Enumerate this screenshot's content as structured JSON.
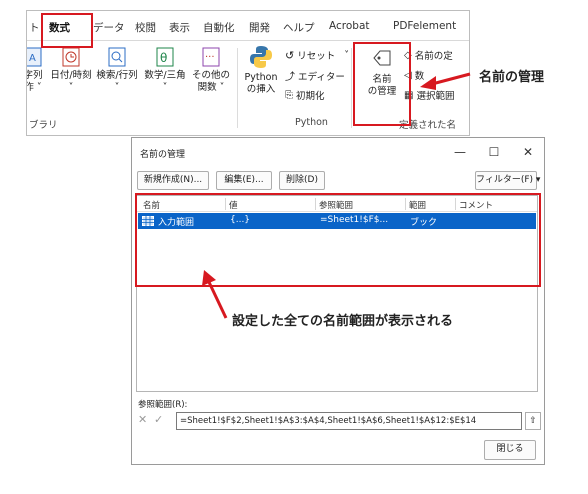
{
  "ribbon": {
    "tabs": [
      "ト",
      "数式",
      "データ",
      "校閲",
      "表示",
      "自動化",
      "開発",
      "ヘルプ",
      "Acrobat",
      "PDFelement"
    ],
    "active_tab": "数式",
    "groups": {
      "library": {
        "label": "ブラリ",
        "buttons": [
          {
            "label": "字列",
            "sub": "作 ˅"
          },
          {
            "label": "日付/時刻",
            "sub": "˅"
          },
          {
            "label": "検索/行列",
            "sub": "˅"
          },
          {
            "label": "数学/三角",
            "sub": "˅"
          },
          {
            "label": "その他の",
            "sub": "関数 ˅"
          }
        ]
      },
      "python": {
        "label": "Python",
        "insert_label": "Python",
        "insert_sub": "の挿入",
        "reset": "リセット",
        "editor": "エディター",
        "init": "初期化",
        "reset_dropdown": "˅"
      },
      "names": {
        "manager_label": "名前",
        "manager_sub": "の管理",
        "define": "名前の定",
        "use": "数",
        "create": "選択範囲",
        "group_label": "定義された名"
      }
    }
  },
  "callouts": {
    "name_manager": "名前の管理",
    "all_ranges": "設定した全ての名前範囲が表示される"
  },
  "dialog": {
    "title": "名前の管理",
    "window_buttons": {
      "minimize": "—",
      "maximize": "☐",
      "close": "✕"
    },
    "buttons": {
      "new": "新規作成(N)...",
      "edit": "編集(E)...",
      "delete": "削除(D)",
      "filter": "フィルター(F) ▾"
    },
    "columns": [
      "名前",
      "値",
      "参照範囲",
      "範囲",
      "コメント"
    ],
    "rows": [
      {
        "name": "入力範囲",
        "value": "{...}",
        "refers_to": "=Sheet1!$F$...",
        "scope": "ブック",
        "comment": ""
      }
    ],
    "refers_to_label": "参照範囲(R):",
    "refers_to_value": "=Sheet1!$F$2,Sheet1!$A$3:$A$4,Sheet1!$A$6,Sheet1!$A$12:$E$14",
    "close": "閉じる"
  },
  "colors": {
    "highlight_red": "#d71920",
    "selection_blue": "#0a64c8"
  }
}
